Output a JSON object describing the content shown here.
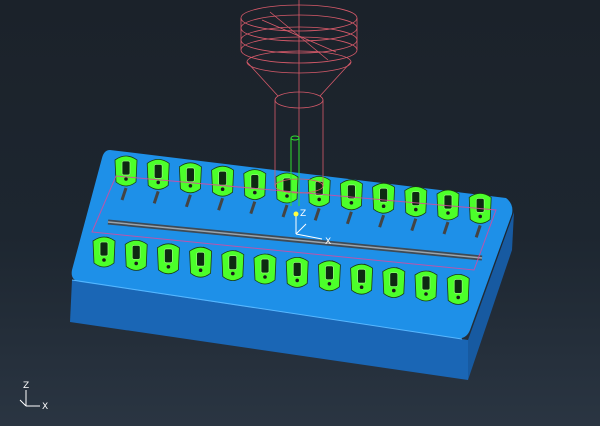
{
  "scene": {
    "background_top": "#1b222a",
    "background_bottom": "#2a3542",
    "block_top_color": "#1e90e8",
    "block_side_color": "#1a6fbf",
    "part_color": "#4cff2a",
    "part_outline": "#1a1a1a",
    "toolpath_color": "#e05a8a",
    "tool_color": "#d65a6a",
    "cavity_rows": 2,
    "cavities_per_row": 12
  },
  "local_axes": {
    "x_label": "X",
    "z_label": "Z"
  },
  "triad": {
    "x_label": "X",
    "z_label": "Z"
  },
  "icons": {
    "tool": "end-mill-tool-icon",
    "triad": "axis-triad-icon"
  }
}
